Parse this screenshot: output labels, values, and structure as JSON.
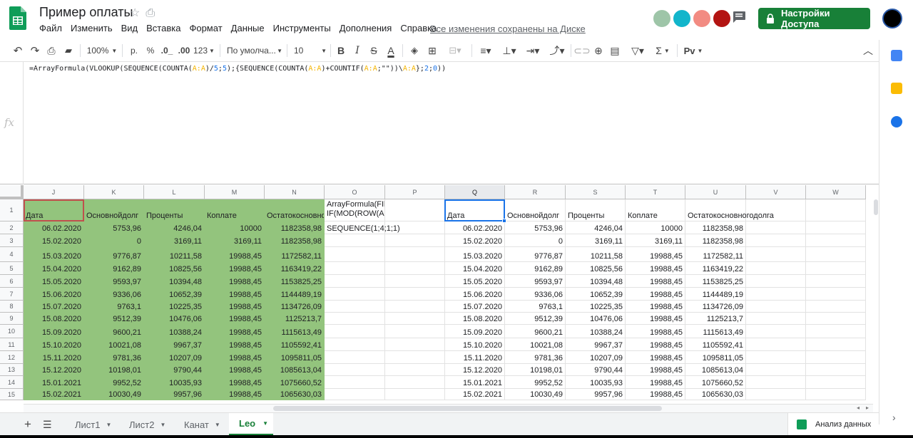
{
  "doc": {
    "title": "Пример оплаты",
    "saved_status": "Все изменения сохранены на Диске"
  },
  "menu": [
    "Файл",
    "Изменить",
    "Вид",
    "Вставка",
    "Формат",
    "Данные",
    "Инструменты",
    "Дополнения",
    "Справка"
  ],
  "share_button": "Настройки Доступа",
  "toolbar": {
    "zoom": "100%",
    "currency": "р.",
    "percent": "%",
    "dec_less": ".0_",
    "dec_more": ".00",
    "more_formats": "123",
    "font": "По умолча...",
    "font_size": "10",
    "bold": "B",
    "italic": "I",
    "strike": "S",
    "text_color": "A",
    "sigma": "Σ",
    "input_tools": "Pv"
  },
  "formula": {
    "fx": "fx",
    "parts": [
      {
        "t": "=ArrayFormula(VLOOKUP(SEQUENCE(COUNTA(",
        "c": "text"
      },
      {
        "t": "A:A",
        "c": "ref"
      },
      {
        "t": ")/",
        "c": "text"
      },
      {
        "t": "5",
        "c": "num"
      },
      {
        "t": ";",
        "c": "text"
      },
      {
        "t": "5",
        "c": "num"
      },
      {
        "t": ");{SEQUENCE(COUNTA(",
        "c": "text"
      },
      {
        "t": "A:A",
        "c": "ref"
      },
      {
        "t": ")+COUNTIF(",
        "c": "text"
      },
      {
        "t": "A:A",
        "c": "ref"
      },
      {
        "t": ";\"\"))\\",
        "c": "text"
      },
      {
        "t": "A:A",
        "c": "ref"
      },
      {
        "t": "};",
        "c": "text"
      },
      {
        "t": "2",
        "c": "num"
      },
      {
        "t": ";",
        "c": "text"
      },
      {
        "t": "0",
        "c": "num"
      },
      {
        "t": "))",
        "c": "text"
      }
    ]
  },
  "columns": [
    "J",
    "K",
    "L",
    "M",
    "N",
    "O",
    "P",
    "Q",
    "R",
    "S",
    "T",
    "U",
    "V",
    "W"
  ],
  "row_numbers": [
    "1",
    "2",
    "3",
    "4",
    "5",
    "6",
    "7",
    "8",
    "9",
    "10",
    "11",
    "12",
    "13",
    "14",
    "15"
  ],
  "headers": [
    "Дата",
    "Основнойдолг",
    "Проценты",
    "Коплате",
    "Остатокосновно"
  ],
  "headers_right": [
    "Дата",
    "Основнойдолг",
    "Проценты",
    "Коплате",
    "Остатокосновногодолга"
  ],
  "o_cells": {
    "o1_line1": "ArrayFormula(FIl",
    "o1_line2": "IF(MOD(ROW(A",
    "o2": "SEQUENCE(1;4;1;1)"
  },
  "rows": [
    [
      "06.02.2020",
      "5753,96",
      "4246,04",
      "10000",
      "1182358,98"
    ],
    [
      "15.02.2020",
      "0",
      "3169,11",
      "3169,11",
      "1182358,98"
    ],
    [
      "15.03.2020",
      "9776,87",
      "10211,58",
      "19988,45",
      "1172582,11"
    ],
    [
      "15.04.2020",
      "9162,89",
      "10825,56",
      "19988,45",
      "1163419,22"
    ],
    [
      "15.05.2020",
      "9593,97",
      "10394,48",
      "19988,45",
      "1153825,25"
    ],
    [
      "15.06.2020",
      "9336,06",
      "10652,39",
      "19988,45",
      "1144489,19"
    ],
    [
      "15.07.2020",
      "9763,1",
      "10225,35",
      "19988,45",
      "1134726,09"
    ],
    [
      "15.08.2020",
      "9512,39",
      "10476,06",
      "19988,45",
      "1125213,7"
    ],
    [
      "15.09.2020",
      "9600,21",
      "10388,24",
      "19988,45",
      "1115613,49"
    ],
    [
      "15.10.2020",
      "10021,08",
      "9967,37",
      "19988,45",
      "1105592,41"
    ],
    [
      "15.11.2020",
      "9781,36",
      "10207,09",
      "19988,45",
      "1095811,05"
    ],
    [
      "15.12.2020",
      "10198,01",
      "9790,44",
      "19988,45",
      "1085613,04"
    ],
    [
      "15.01.2021",
      "9952,52",
      "10035,93",
      "19988,45",
      "1075660,52"
    ],
    [
      "15.02.2021",
      "10030,49",
      "9957,96",
      "19988,45",
      "1065630,03"
    ]
  ],
  "tabs": [
    "Лист1",
    "Лист2",
    "Канат",
    "Leo"
  ],
  "active_tab": "Leo",
  "explore_label": "Анализ данных",
  "colors": {
    "green_fill": "#93c47d",
    "share_green": "#188038",
    "ref_color": "#f4b400",
    "num_color": "#1a73e8"
  }
}
